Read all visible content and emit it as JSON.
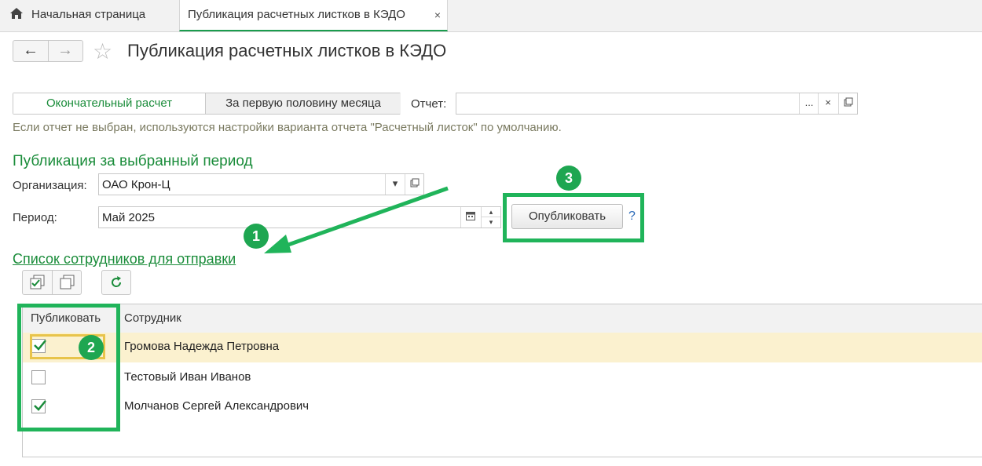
{
  "tabs": {
    "home_label": "Начальная страница",
    "active_label": "Публикация расчетных листков в КЭДО",
    "close_glyph": "×"
  },
  "nav": {
    "back": "←",
    "forward": "→"
  },
  "title": "Публикация расчетных листков в КЭДО",
  "toggle": {
    "final": "Окончательный расчет",
    "first_half": "За первую половину месяца",
    "selected": "final"
  },
  "report": {
    "label": "Отчет:",
    "value": "",
    "select_btn": "...",
    "clear_btn": "×"
  },
  "hint": "Если отчет не выбран, используются настройки варианта отчета \"Расчетный листок\" по умолчанию.",
  "section_title": "Публикация за выбранный период",
  "organization": {
    "label": "Организация:",
    "value": "ОАО Крон-Ц"
  },
  "period": {
    "label": "Период:",
    "value": "Май 2025"
  },
  "publish_button": "Опубликовать",
  "help": "?",
  "list_title": "Список сотрудников для отправки",
  "table": {
    "columns": [
      "Публиковать",
      "Сотрудник"
    ],
    "rows": [
      {
        "publish": true,
        "name": "Громова Надежда Петровна",
        "selected": true
      },
      {
        "publish": false,
        "name": "Тестовый Иван Иванов",
        "selected": false
      },
      {
        "publish": true,
        "name": "Молчанов Сергей Александрович",
        "selected": false
      }
    ]
  },
  "annotations": {
    "badge1": "1",
    "badge2": "2",
    "badge3": "3"
  },
  "colors": {
    "accent_green": "#1a8c3a",
    "annotation_green": "#20b45a",
    "selected_row": "#fbf1cf"
  }
}
